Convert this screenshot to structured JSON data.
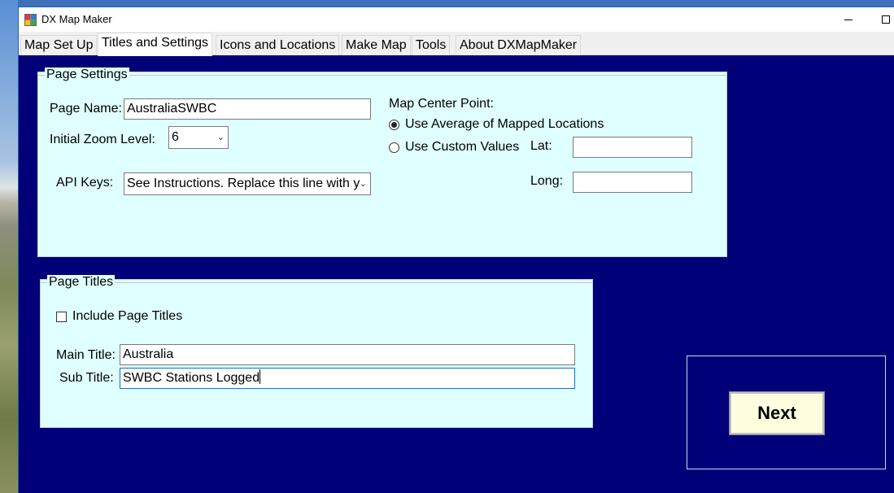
{
  "window": {
    "title": "DX Map Maker"
  },
  "tabs": [
    {
      "label": "Map Set Up"
    },
    {
      "label": "Titles and Settings"
    },
    {
      "label": "Icons and Locations"
    },
    {
      "label": "Make Map"
    },
    {
      "label": "Tools"
    },
    {
      "label": "About DXMapMaker"
    }
  ],
  "active_tab": "Titles and Settings",
  "page_settings": {
    "legend": "Page Settings",
    "page_name_label": "Page Name:",
    "page_name_value": "AustraliaSWBC",
    "zoom_label": "Initial Zoom Level:",
    "zoom_value": "6",
    "api_keys_label": "API Keys:",
    "api_keys_value": "See Instructions. Replace this line with y",
    "map_center_label": "Map Center Point:",
    "radio_average": "Use Average of Mapped Locations",
    "radio_custom": "Use Custom Values",
    "selected_radio": "Use Average of Mapped Locations",
    "lat_label": "Lat:",
    "lat_value": "",
    "long_label": "Long:",
    "long_value": ""
  },
  "page_titles": {
    "legend": "Page Titles",
    "include_label": "Include Page Titles",
    "include_checked": false,
    "main_title_label": "Main Title:",
    "main_title_value": "Australia",
    "sub_title_label": "Sub Title:",
    "sub_title_value": "SWBC Stations Logged"
  },
  "next_button": {
    "label": "Next"
  },
  "colors": {
    "content_background": "#020078",
    "group_background": "#e0ffff",
    "next_button_background": "#ffffe0"
  }
}
